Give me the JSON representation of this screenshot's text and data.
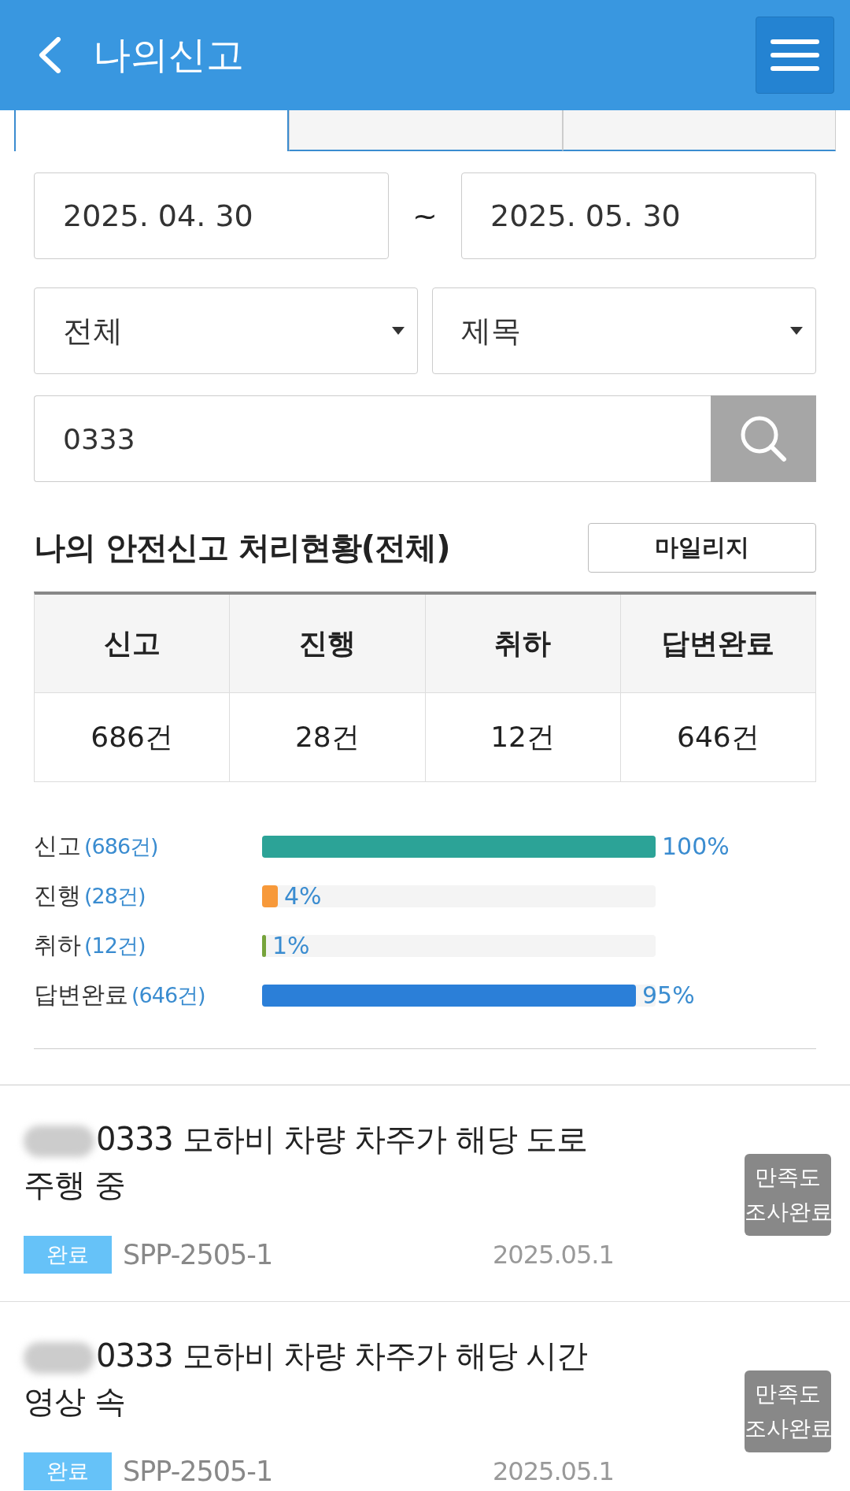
{
  "header": {
    "title": "나의신고"
  },
  "tabs": [
    {
      "selected": true
    },
    {
      "selected": false
    },
    {
      "selected": false
    }
  ],
  "filters": {
    "date_from": "2025. 04. 30",
    "separator": "~",
    "date_to": "2025. 05. 30",
    "category": "전체",
    "field": "제목",
    "search": "0333"
  },
  "summary": {
    "title": "나의 안전신고 처리현황(전체)",
    "mileage_button": "마일리지",
    "columns": [
      "신고",
      "진행",
      "취하",
      "답변완료"
    ],
    "values": [
      "686건",
      "28건",
      "12건",
      "646건"
    ]
  },
  "bars": [
    {
      "label": "신고",
      "count": "(686건)",
      "level": 1,
      "percent": "100%",
      "color": "#2ca397"
    },
    {
      "label": "진행",
      "count": "(28건)",
      "level": 0.04,
      "percent": "4%",
      "color": "#f7993a"
    },
    {
      "label": "취하",
      "count": "(12건)",
      "level": 0.01,
      "percent": "1%",
      "color": "#76a33b"
    },
    {
      "label": "답변완료",
      "count": "(646건)",
      "level": 0.95,
      "percent": "95%",
      "color": "#2b7fd8"
    }
  ],
  "reports": [
    {
      "title": "0333 모하비 차량 차주가 해당 도로 주행 중",
      "status": "완료",
      "number": "SPP-2505-1",
      "date": "2025.05.1",
      "badge": "만족도 조사완료"
    },
    {
      "title": "0333 모하비 차량 차주가 해당 시간 영상 속",
      "status": "완료",
      "number": "SPP-2505-1",
      "date": "2025.05.1",
      "badge": "만족도 조사완료"
    }
  ]
}
